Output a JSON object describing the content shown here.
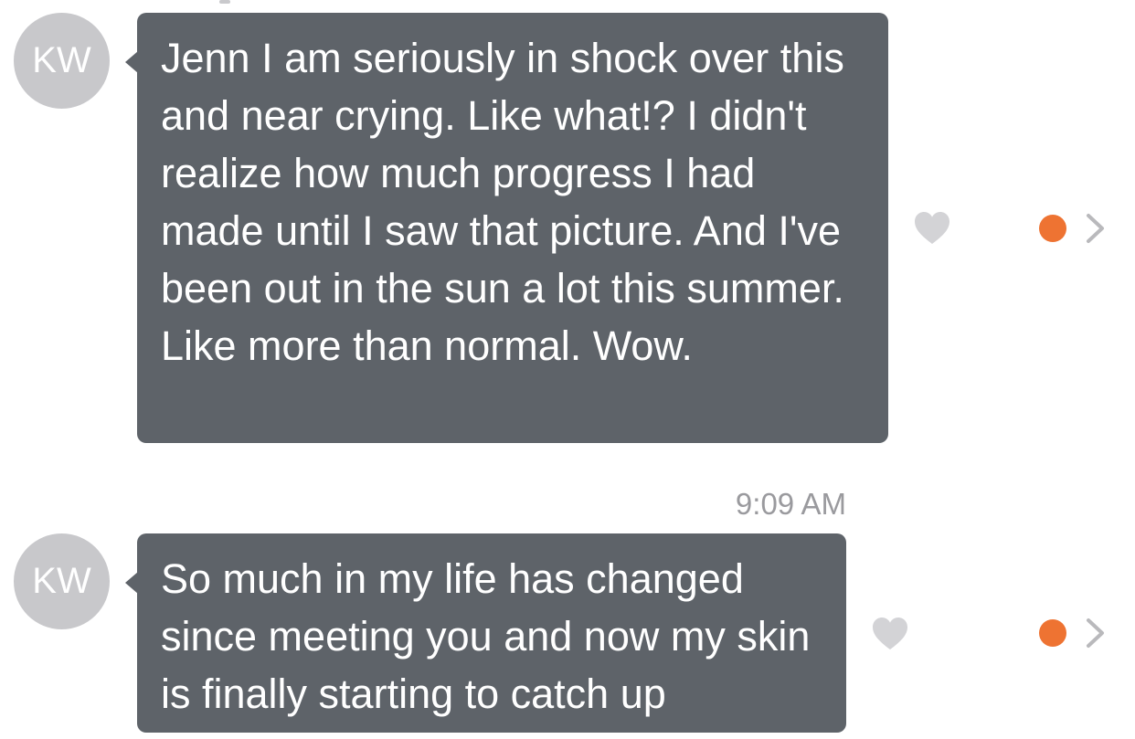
{
  "messages": [
    {
      "avatar_initials": "KW",
      "text": "Jenn I am seriously in shock over this and near crying. Like what!? I didn't realize how much progress I had made until I saw that picture. And I've been out in the sun a lot this summer. Like more than normal. Wow.",
      "liked": false
    },
    {
      "avatar_initials": "KW",
      "timestamp": "9:09 AM",
      "text": "So much in my life has changed since meeting you and now my skin is finally starting to catch up",
      "liked": false
    }
  ],
  "colors": {
    "bubble": "#5e6369",
    "avatar": "#c8c8cb",
    "heart": "#d3d3d6",
    "unread_dot": "#ee7332",
    "chevron": "#b9b9bc",
    "timestamp": "#9a9a9e"
  },
  "icons": {
    "like": "heart-icon",
    "unread": "unread-dot-icon",
    "expand": "chevron-right-icon"
  }
}
